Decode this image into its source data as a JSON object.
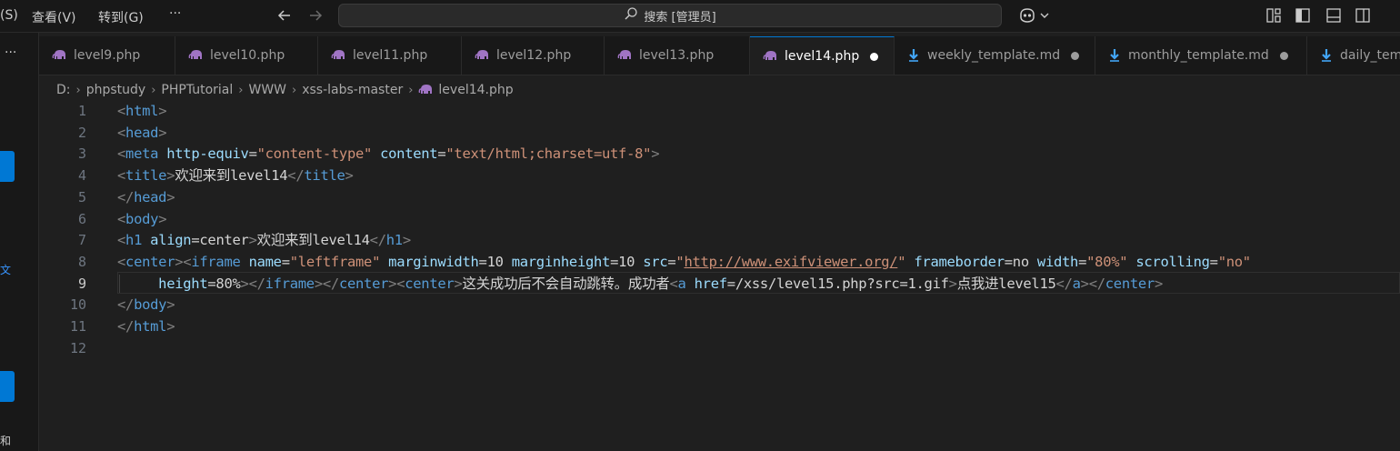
{
  "menu": {
    "selection_fragment": "(S)",
    "view": "查看(V)",
    "goto": "转到(G)",
    "more": "···"
  },
  "search": {
    "text": "搜索 [管理员]"
  },
  "activity": {
    "more": "···",
    "chars": [
      " ",
      " ",
      "文",
      " ",
      "和"
    ]
  },
  "tabs": [
    {
      "label": "level9.php",
      "icon": "php-elephant-icon",
      "dirty": false,
      "active": false
    },
    {
      "label": "level10.php",
      "icon": "php-elephant-icon",
      "dirty": false,
      "active": false
    },
    {
      "label": "level11.php",
      "icon": "php-elephant-icon",
      "dirty": false,
      "active": false
    },
    {
      "label": "level12.php",
      "icon": "php-elephant-icon",
      "dirty": false,
      "active": false
    },
    {
      "label": "level13.php",
      "icon": "php-elephant-icon",
      "dirty": false,
      "active": false
    },
    {
      "label": "level14.php",
      "icon": "php-elephant-icon",
      "dirty": true,
      "active": true
    },
    {
      "label": "weekly_template.md",
      "icon": "markdown-download-icon",
      "dirty": true,
      "active": false
    },
    {
      "label": "monthly_template.md",
      "icon": "markdown-download-icon",
      "dirty": true,
      "active": false
    },
    {
      "label": "daily_tem",
      "icon": "markdown-download-icon",
      "dirty": false,
      "active": false
    }
  ],
  "breadcrumb": [
    "D:",
    "phpstudy",
    "PHPTutorial",
    "WWW",
    "xss-labs-master",
    "level14.php"
  ],
  "editor": {
    "current_line": 9,
    "line_numbers": [
      "1",
      "2",
      "3",
      "4",
      "5",
      "6",
      "7",
      "8",
      "9",
      "10",
      "11",
      "12"
    ],
    "lines": [
      [
        [
          "p",
          "<"
        ],
        [
          "t",
          "html"
        ],
        [
          "p",
          ">"
        ]
      ],
      [
        [
          "p",
          "<"
        ],
        [
          "t",
          "head"
        ],
        [
          "p",
          ">"
        ]
      ],
      [
        [
          "p",
          "<"
        ],
        [
          "t",
          "meta"
        ],
        [
          "x",
          " "
        ],
        [
          "a",
          "http-equiv"
        ],
        [
          "o",
          "="
        ],
        [
          "s",
          "\"content-type\""
        ],
        [
          "x",
          " "
        ],
        [
          "a",
          "content"
        ],
        [
          "o",
          "="
        ],
        [
          "s",
          "\"text/html;charset=utf-8\""
        ],
        [
          "p",
          ">"
        ]
      ],
      [
        [
          "p",
          "<"
        ],
        [
          "t",
          "title"
        ],
        [
          "p",
          ">"
        ],
        [
          "x",
          "欢迎来到level14"
        ],
        [
          "p",
          "</"
        ],
        [
          "t",
          "title"
        ],
        [
          "p",
          ">"
        ]
      ],
      [
        [
          "p",
          "</"
        ],
        [
          "t",
          "head"
        ],
        [
          "p",
          ">"
        ]
      ],
      [
        [
          "p",
          "<"
        ],
        [
          "t",
          "body"
        ],
        [
          "p",
          ">"
        ]
      ],
      [
        [
          "p",
          "<"
        ],
        [
          "t",
          "h1"
        ],
        [
          "x",
          " "
        ],
        [
          "a",
          "align"
        ],
        [
          "o",
          "="
        ],
        [
          "x",
          "center"
        ],
        [
          "p",
          ">"
        ],
        [
          "x",
          "欢迎来到level14"
        ],
        [
          "p",
          "</"
        ],
        [
          "t",
          "h1"
        ],
        [
          "p",
          ">"
        ]
      ],
      [
        [
          "p",
          "<"
        ],
        [
          "t",
          "center"
        ],
        [
          "p",
          "><"
        ],
        [
          "t",
          "iframe"
        ],
        [
          "x",
          " "
        ],
        [
          "a",
          "name"
        ],
        [
          "o",
          "="
        ],
        [
          "s",
          "\"leftframe\""
        ],
        [
          "x",
          " "
        ],
        [
          "a",
          "marginwidth"
        ],
        [
          "o",
          "="
        ],
        [
          "x",
          "10"
        ],
        [
          "x",
          " "
        ],
        [
          "a",
          "marginheight"
        ],
        [
          "o",
          "="
        ],
        [
          "x",
          "10"
        ],
        [
          "x",
          " "
        ],
        [
          "a",
          "src"
        ],
        [
          "o",
          "="
        ],
        [
          "s",
          "\""
        ],
        [
          "u",
          "http://www.exifviewer.org/"
        ],
        [
          "s",
          "\""
        ],
        [
          "x",
          " "
        ],
        [
          "a",
          "frameborder"
        ],
        [
          "o",
          "="
        ],
        [
          "x",
          "no"
        ],
        [
          "x",
          " "
        ],
        [
          "a",
          "width"
        ],
        [
          "o",
          "="
        ],
        [
          "s",
          "\"80%\""
        ],
        [
          "x",
          " "
        ],
        [
          "a",
          "scrolling"
        ],
        [
          "o",
          "="
        ],
        [
          "s",
          "\"no\""
        ]
      ],
      [
        [
          "x",
          "     "
        ],
        [
          "a",
          "height"
        ],
        [
          "o",
          "="
        ],
        [
          "x",
          "80%"
        ],
        [
          "p",
          "></"
        ],
        [
          "t",
          "iframe"
        ],
        [
          "p",
          "></"
        ],
        [
          "t",
          "center"
        ],
        [
          "p",
          "><"
        ],
        [
          "t",
          "center"
        ],
        [
          "p",
          ">"
        ],
        [
          "x",
          "这关成功后不会自动跳转。成功者"
        ],
        [
          "p",
          "<"
        ],
        [
          "t",
          "a"
        ],
        [
          "x",
          " "
        ],
        [
          "a",
          "href"
        ],
        [
          "o",
          "="
        ],
        [
          "x",
          "/xss/level15.php?src=1.gif"
        ],
        [
          "p",
          ">"
        ],
        [
          "x",
          "点我进level15"
        ],
        [
          "p",
          "</"
        ],
        [
          "t",
          "a"
        ],
        [
          "p",
          "></"
        ],
        [
          "t",
          "center"
        ],
        [
          "p",
          ">"
        ]
      ],
      [
        [
          "p",
          "</"
        ],
        [
          "t",
          "body"
        ],
        [
          "p",
          ">"
        ]
      ],
      [
        [
          "p",
          "</"
        ],
        [
          "t",
          "html"
        ],
        [
          "p",
          ">"
        ]
      ],
      []
    ]
  },
  "colors": {
    "background": "#1f1f1f",
    "tag": "#569cd6",
    "attribute": "#9cdcfe",
    "string": "#ce9178",
    "accent": "#0078d4"
  }
}
